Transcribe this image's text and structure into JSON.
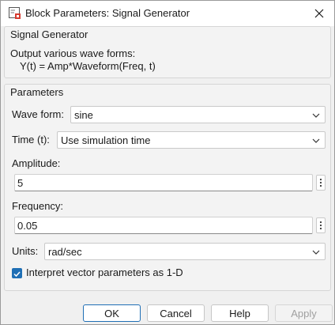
{
  "window": {
    "title": "Block Parameters: Signal Generator",
    "icons": {
      "app": "block-parameters-icon",
      "close": "close-icon"
    }
  },
  "block_group": {
    "header": "Signal Generator",
    "description_line1": "Output various wave forms:",
    "description_line2": "Y(t) = Amp*Waveform(Freq, t)"
  },
  "parameters": {
    "header": "Parameters",
    "wave_form": {
      "label": "Wave form:",
      "value": "sine"
    },
    "time": {
      "label": "Time (t):",
      "value": "Use simulation time"
    },
    "amplitude": {
      "label": "Amplitude:",
      "value": "5"
    },
    "frequency": {
      "label": "Frequency:",
      "value": "0.05"
    },
    "units": {
      "label": "Units:",
      "value": "rad/sec"
    },
    "interpret_vector": {
      "label": "Interpret vector parameters as 1-D",
      "checked": true
    }
  },
  "buttons": {
    "ok": "OK",
    "cancel": "Cancel",
    "help": "Help",
    "apply": "Apply",
    "apply_enabled": false
  },
  "colors": {
    "accent": "#1f6fb5",
    "window_bg": "#f0f0f0",
    "disabled_text": "#a0a0a0"
  }
}
